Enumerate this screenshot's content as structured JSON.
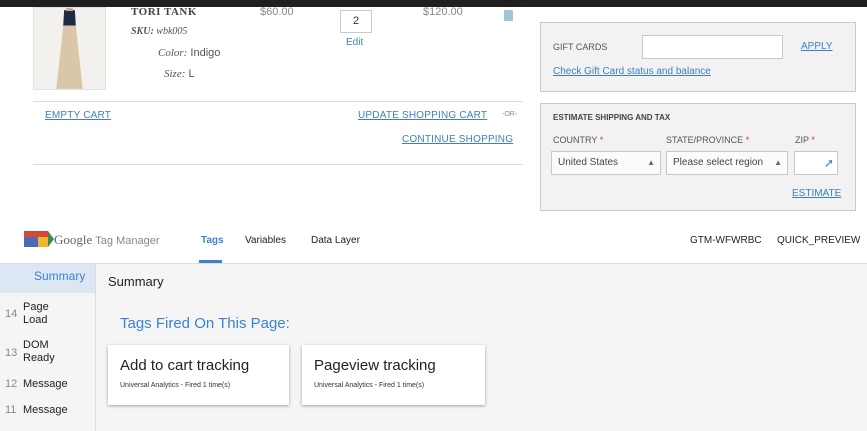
{
  "cart": {
    "item": {
      "name": "TORI TANK",
      "sku_label": "SKU:",
      "sku": "wbk005",
      "color_label": "Color:",
      "color": "Indigo",
      "size_label": "Size:",
      "size": "L",
      "price": "$60.00",
      "qty": "2",
      "edit": "Edit",
      "subtotal": "$120.00"
    },
    "empty_cart": "EMPTY CART",
    "update_cart": "UPDATE SHOPPING CART",
    "or": "-OR-",
    "continue_shopping": "CONTINUE SHOPPING"
  },
  "gift": {
    "label": "GIFT CARDS",
    "apply": "APPLY",
    "check": "Check Gift Card status and balance"
  },
  "shipping": {
    "title": "ESTIMATE SHIPPING AND TAX",
    "country_label": "COUNTRY",
    "state_label": "STATE/PROVINCE",
    "zip_label": "ZIP",
    "required_mark": "*",
    "country_value": "United States",
    "state_value": "Please select region",
    "estimate": "ESTIMATE"
  },
  "gtm": {
    "brand_google": "Google",
    "brand_tm": "Tag Manager",
    "tabs": [
      "Tags",
      "Variables",
      "Data Layer"
    ],
    "container_id": "GTM-WFWRBC",
    "preview": "QUICK_PREVIEW",
    "sidebar": [
      {
        "num": "",
        "name": "Summary"
      },
      {
        "num": "14",
        "name": "Page Load"
      },
      {
        "num": "13",
        "name": "DOM Ready"
      },
      {
        "num": "12",
        "name": "Message"
      },
      {
        "num": "11",
        "name": "Message"
      }
    ],
    "summary_title": "Summary",
    "fired_heading": "Tags Fired On This Page:",
    "fired_tags": [
      {
        "name": "Add to cart tracking",
        "meta": "Universal Analytics - Fired 1 time(s)"
      },
      {
        "name": "Pageview tracking",
        "meta": "Universal Analytics - Fired 1 time(s)"
      }
    ]
  },
  "colors": {
    "link": "#3a80c4",
    "gtm_accent": "#3b83cf",
    "required": "#d33333"
  }
}
